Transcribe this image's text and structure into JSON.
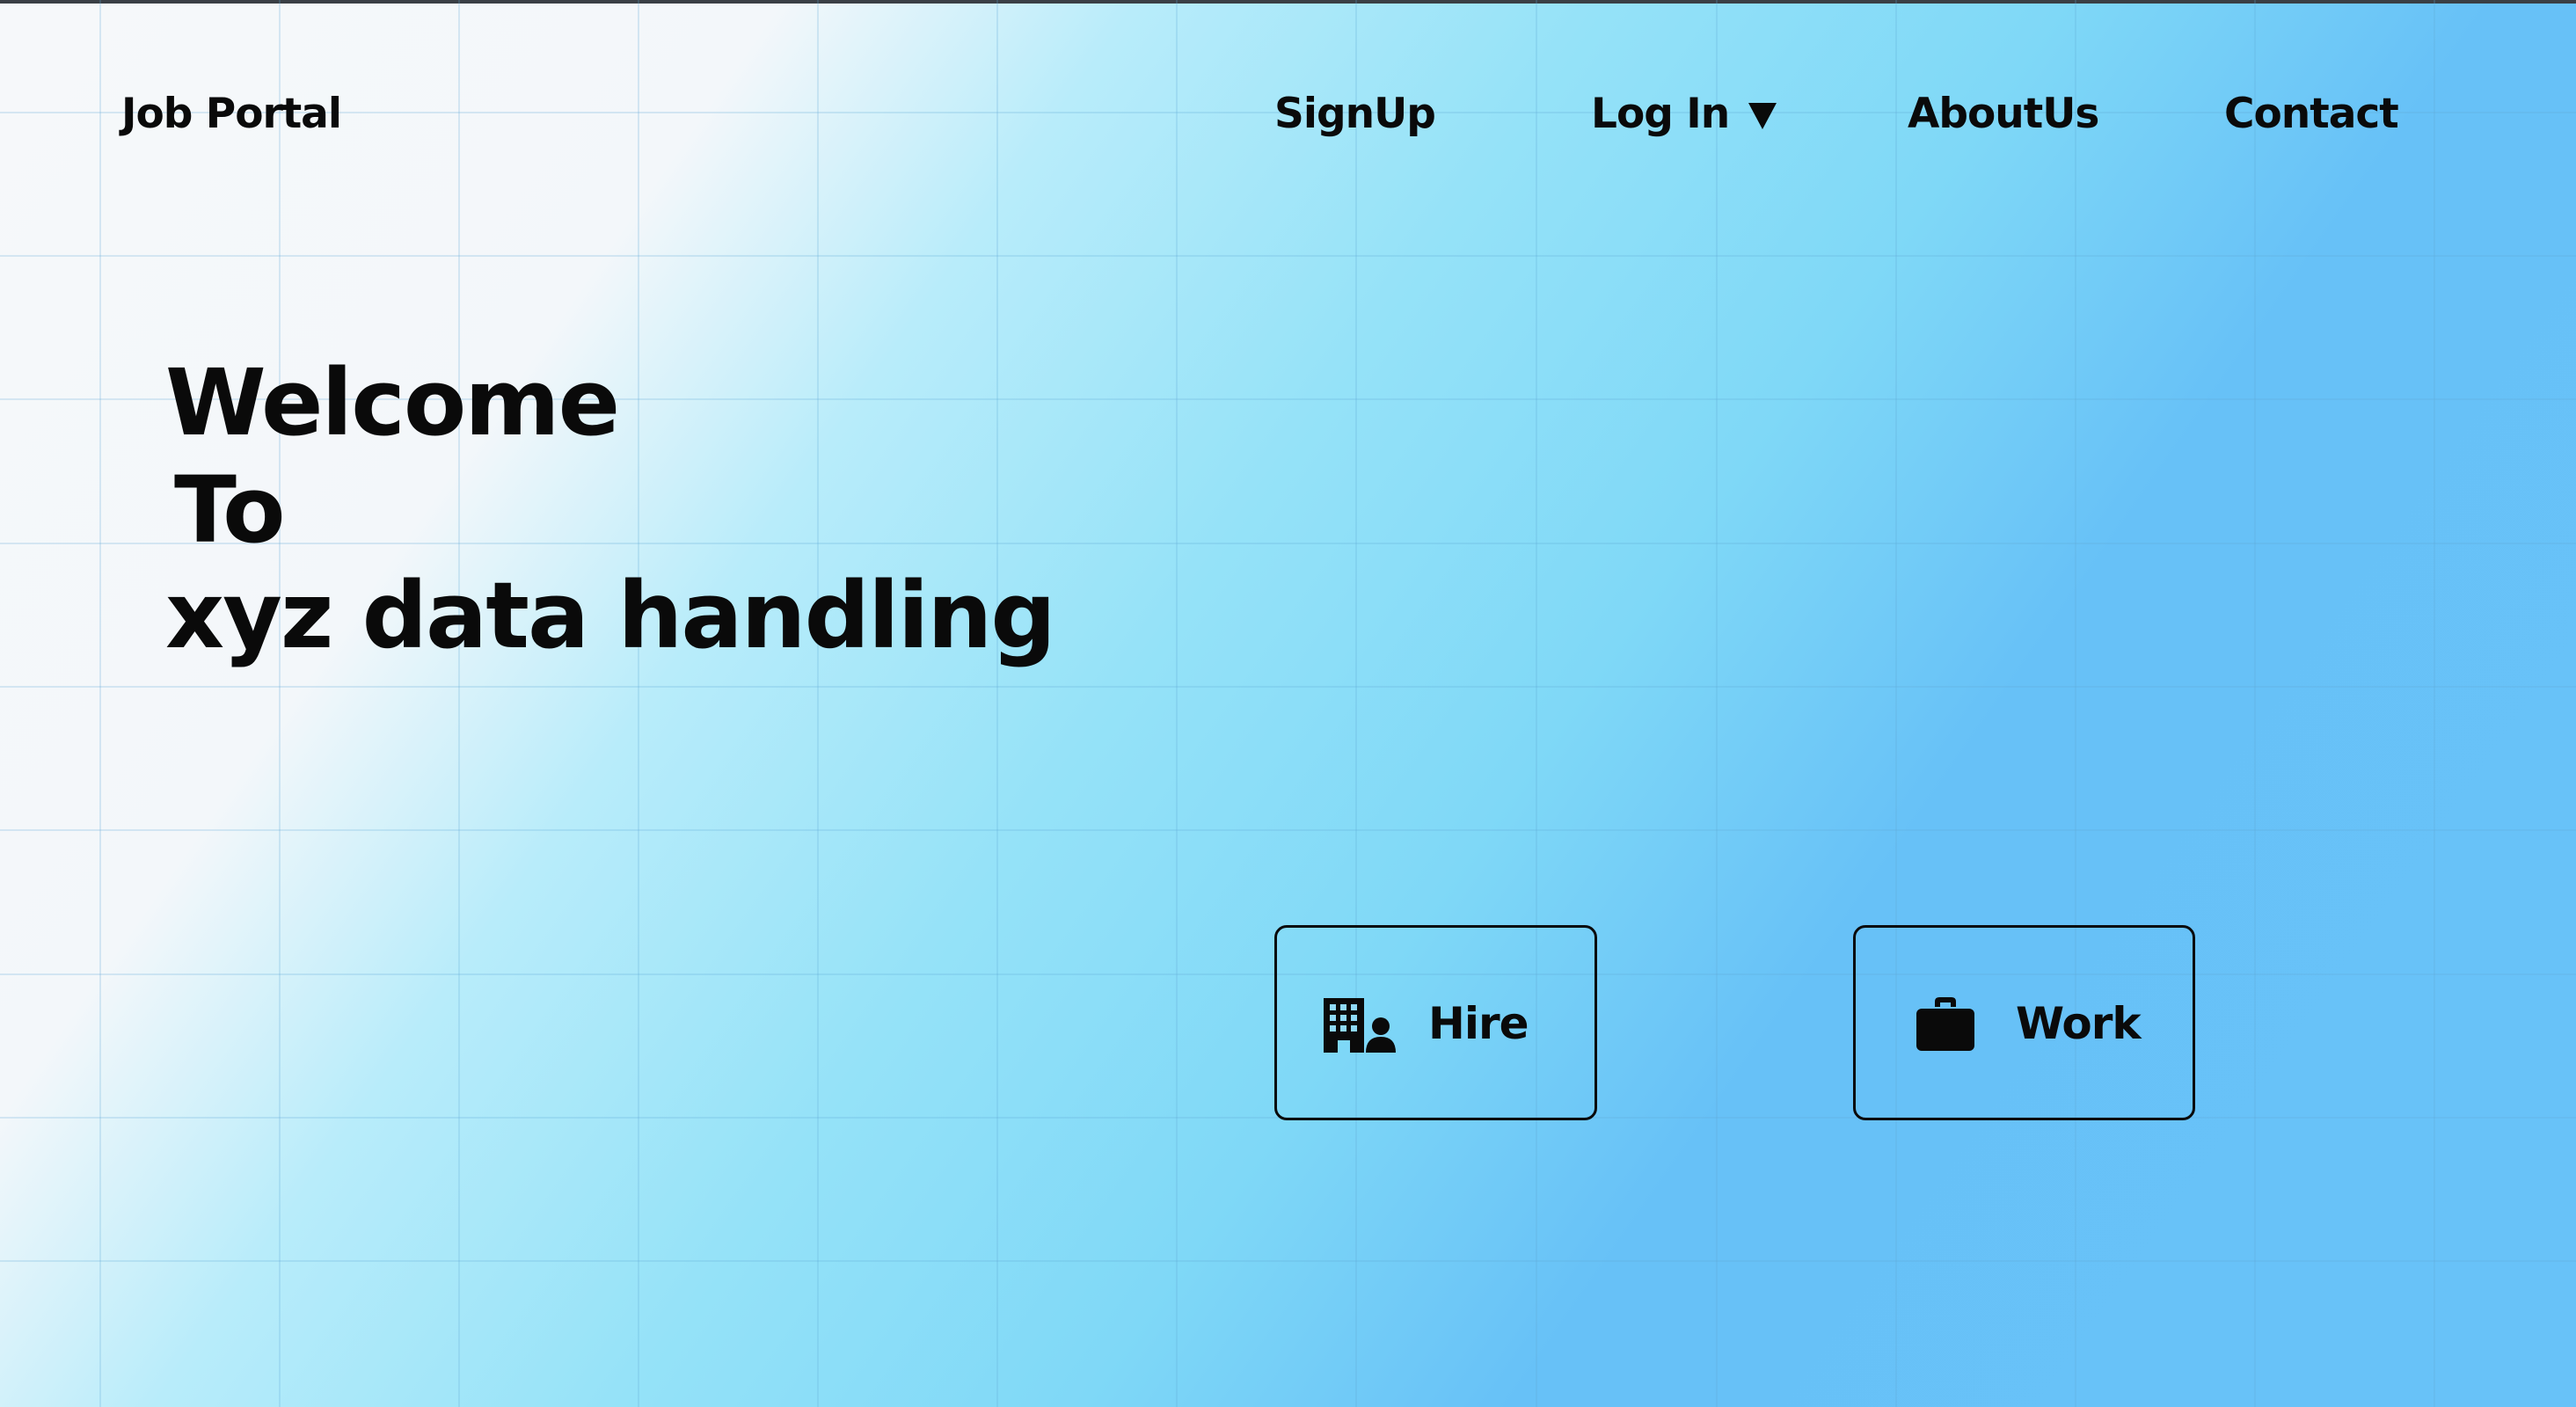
{
  "header": {
    "logo": "Job Portal",
    "nav": {
      "signup": "SignUp",
      "login": "Log In",
      "about": "AboutUs",
      "contact": "Contact"
    }
  },
  "hero": {
    "line1": "Welcome",
    "line2": "To",
    "line3": "xyz data handling"
  },
  "actions": {
    "hire_label": "Hire",
    "hire_icon": "building-person-icon",
    "work_label": "Work",
    "work_icon": "briefcase-icon"
  },
  "colors": {
    "text": "#0a0a0a",
    "background_light": "#f4f7fa",
    "background_mid": "#7fd8f7",
    "background_deep": "#67c1f7",
    "grid_line": "#9fd6ee"
  }
}
